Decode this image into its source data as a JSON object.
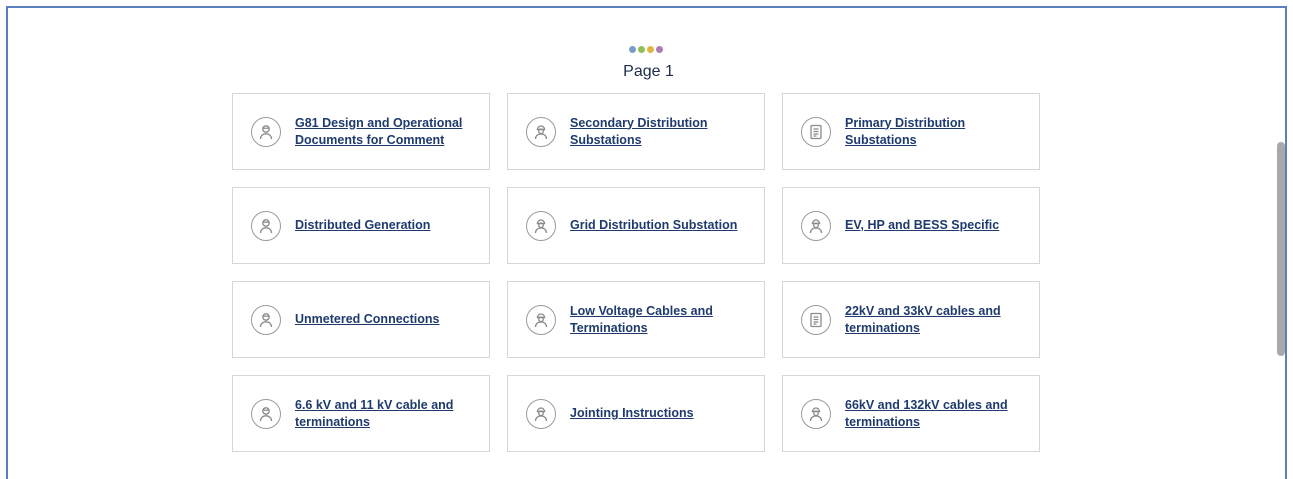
{
  "header": {
    "title": "Page 1",
    "dot_colors": [
      "#7a9cc6",
      "#8dbf5a",
      "#e0b640",
      "#b07ab8"
    ]
  },
  "cards": [
    {
      "label": "G81 Design and Operational Documents for Comment",
      "icon": "worker-icon"
    },
    {
      "label": "Secondary Distribution Substations",
      "icon": "hardhat-worker-icon"
    },
    {
      "label": "Primary Distribution Substations",
      "icon": "document-icon"
    },
    {
      "label": "Distributed Generation",
      "icon": "worker-icon"
    },
    {
      "label": "Grid Distribution Substation",
      "icon": "hardhat-worker-icon"
    },
    {
      "label": "EV, HP and BESS Specific",
      "icon": "hardhat-worker-icon"
    },
    {
      "label": "Unmetered Connections",
      "icon": "worker-icon"
    },
    {
      "label": "Low Voltage Cables and Terminations",
      "icon": "hardhat-worker-icon"
    },
    {
      "label": "22kV and 33kV cables and terminations",
      "icon": "document-icon"
    },
    {
      "label": "6.6 kV and 11 kV cable and terminations",
      "icon": "worker-icon"
    },
    {
      "label": "Jointing Instructions",
      "icon": "hardhat-worker-icon"
    },
    {
      "label": "66kV and 132kV cables and terminations",
      "icon": "hardhat-worker-icon"
    }
  ]
}
